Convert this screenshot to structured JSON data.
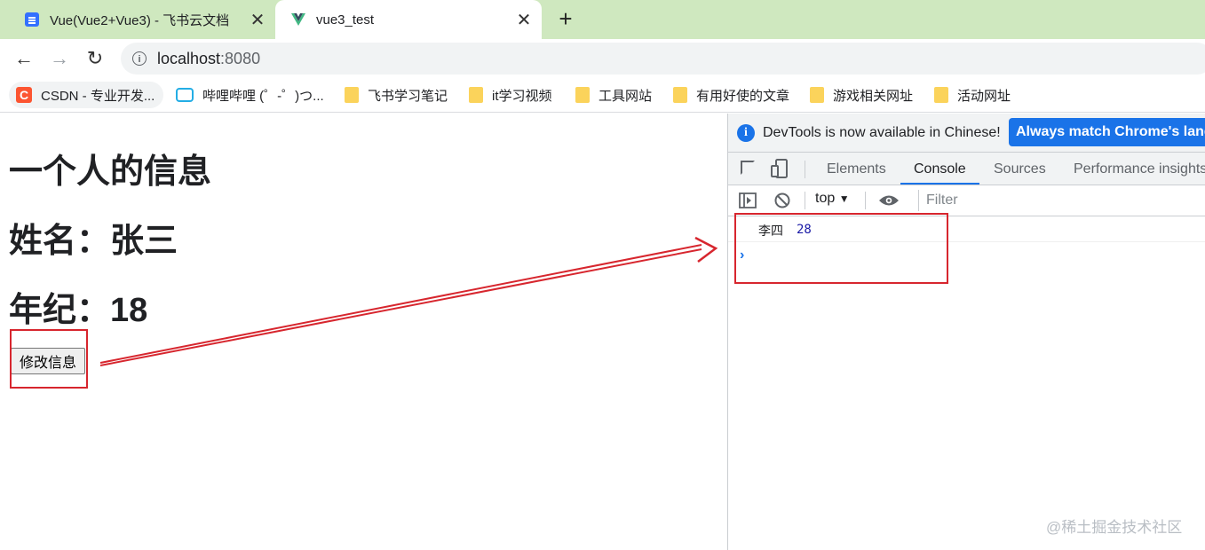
{
  "tabs": [
    {
      "title": "Vue(Vue2+Vue3) - 飞书云文档",
      "close": "✕"
    },
    {
      "title": "vue3_test",
      "close": "✕"
    }
  ],
  "new_tab": "+",
  "toolbar": {
    "back": "←",
    "forward": "→",
    "reload": "↻",
    "url_host": "localhost",
    "url_port": ":8080"
  },
  "bookmarks": [
    {
      "label": "CSDN - 专业开发...",
      "icon": "csdn-icon"
    },
    {
      "label": "哔哩哔哩 (゜-゜)つ...",
      "icon": "bilibili-icon"
    },
    {
      "label": "飞书学习笔记",
      "icon": "folder-icon"
    },
    {
      "label": "it学习视频",
      "icon": "folder-icon"
    },
    {
      "label": "工具网站",
      "icon": "folder-icon"
    },
    {
      "label": "有用好使的文章",
      "icon": "folder-icon"
    },
    {
      "label": "游戏相关网址",
      "icon": "folder-icon"
    },
    {
      "label": "活动网址",
      "icon": "folder-icon"
    }
  ],
  "page": {
    "title": "一个人的信息",
    "name_line": "姓名：张三",
    "age_line": "年纪：18",
    "button": "修改信息"
  },
  "devtools": {
    "banner_text": "DevTools is now available in Chinese!",
    "banner_button": "Always match Chrome's language",
    "tabs": [
      "Elements",
      "Console",
      "Sources",
      "Performance insights"
    ],
    "active_tab": "Console",
    "context": "top",
    "filter_placeholder": "Filter",
    "log": {
      "text": "李四",
      "number": "28"
    },
    "prompt": "›"
  },
  "watermark": "@稀土掘金技术社区",
  "colors": {
    "annotation": "#d7262e",
    "accent": "#1a73e8",
    "tabstrip": "#cfe8bf"
  }
}
